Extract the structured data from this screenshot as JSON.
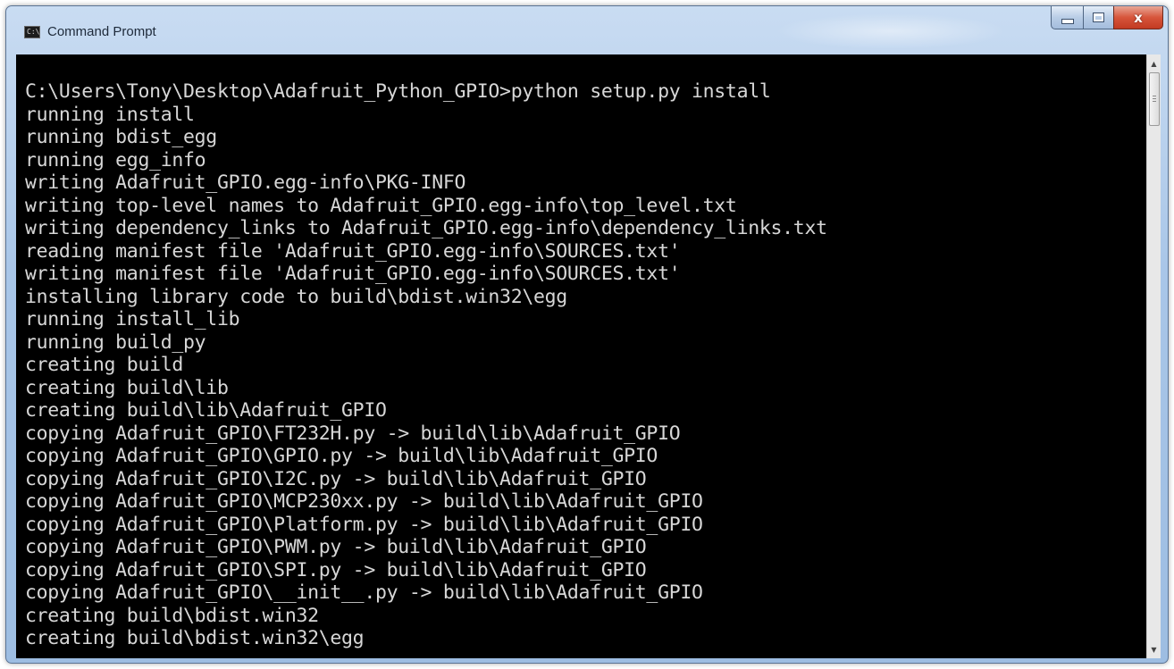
{
  "window": {
    "title": "Command Prompt",
    "app_icon_glyph": "C:\\",
    "controls": {
      "minimize": "minimize",
      "maximize": "maximize",
      "close_glyph": "x"
    }
  },
  "console": {
    "lines": [
      "C:\\Users\\Tony\\Desktop\\Adafruit_Python_GPIO>python setup.py install",
      "running install",
      "running bdist_egg",
      "running egg_info",
      "writing Adafruit_GPIO.egg-info\\PKG-INFO",
      "writing top-level names to Adafruit_GPIO.egg-info\\top_level.txt",
      "writing dependency_links to Adafruit_GPIO.egg-info\\dependency_links.txt",
      "reading manifest file 'Adafruit_GPIO.egg-info\\SOURCES.txt'",
      "writing manifest file 'Adafruit_GPIO.egg-info\\SOURCES.txt'",
      "installing library code to build\\bdist.win32\\egg",
      "running install_lib",
      "running build_py",
      "creating build",
      "creating build\\lib",
      "creating build\\lib\\Adafruit_GPIO",
      "copying Adafruit_GPIO\\FT232H.py -> build\\lib\\Adafruit_GPIO",
      "copying Adafruit_GPIO\\GPIO.py -> build\\lib\\Adafruit_GPIO",
      "copying Adafruit_GPIO\\I2C.py -> build\\lib\\Adafruit_GPIO",
      "copying Adafruit_GPIO\\MCP230xx.py -> build\\lib\\Adafruit_GPIO",
      "copying Adafruit_GPIO\\Platform.py -> build\\lib\\Adafruit_GPIO",
      "copying Adafruit_GPIO\\PWM.py -> build\\lib\\Adafruit_GPIO",
      "copying Adafruit_GPIO\\SPI.py -> build\\lib\\Adafruit_GPIO",
      "copying Adafruit_GPIO\\__init__.py -> build\\lib\\Adafruit_GPIO",
      "creating build\\bdist.win32",
      "creating build\\bdist.win32\\egg"
    ],
    "text_color": "#d7d7d7",
    "background_color": "#000000"
  },
  "scrollbar": {
    "up_icon": "scroll-up-arrow-icon",
    "down_icon": "scroll-down-arrow-icon"
  }
}
